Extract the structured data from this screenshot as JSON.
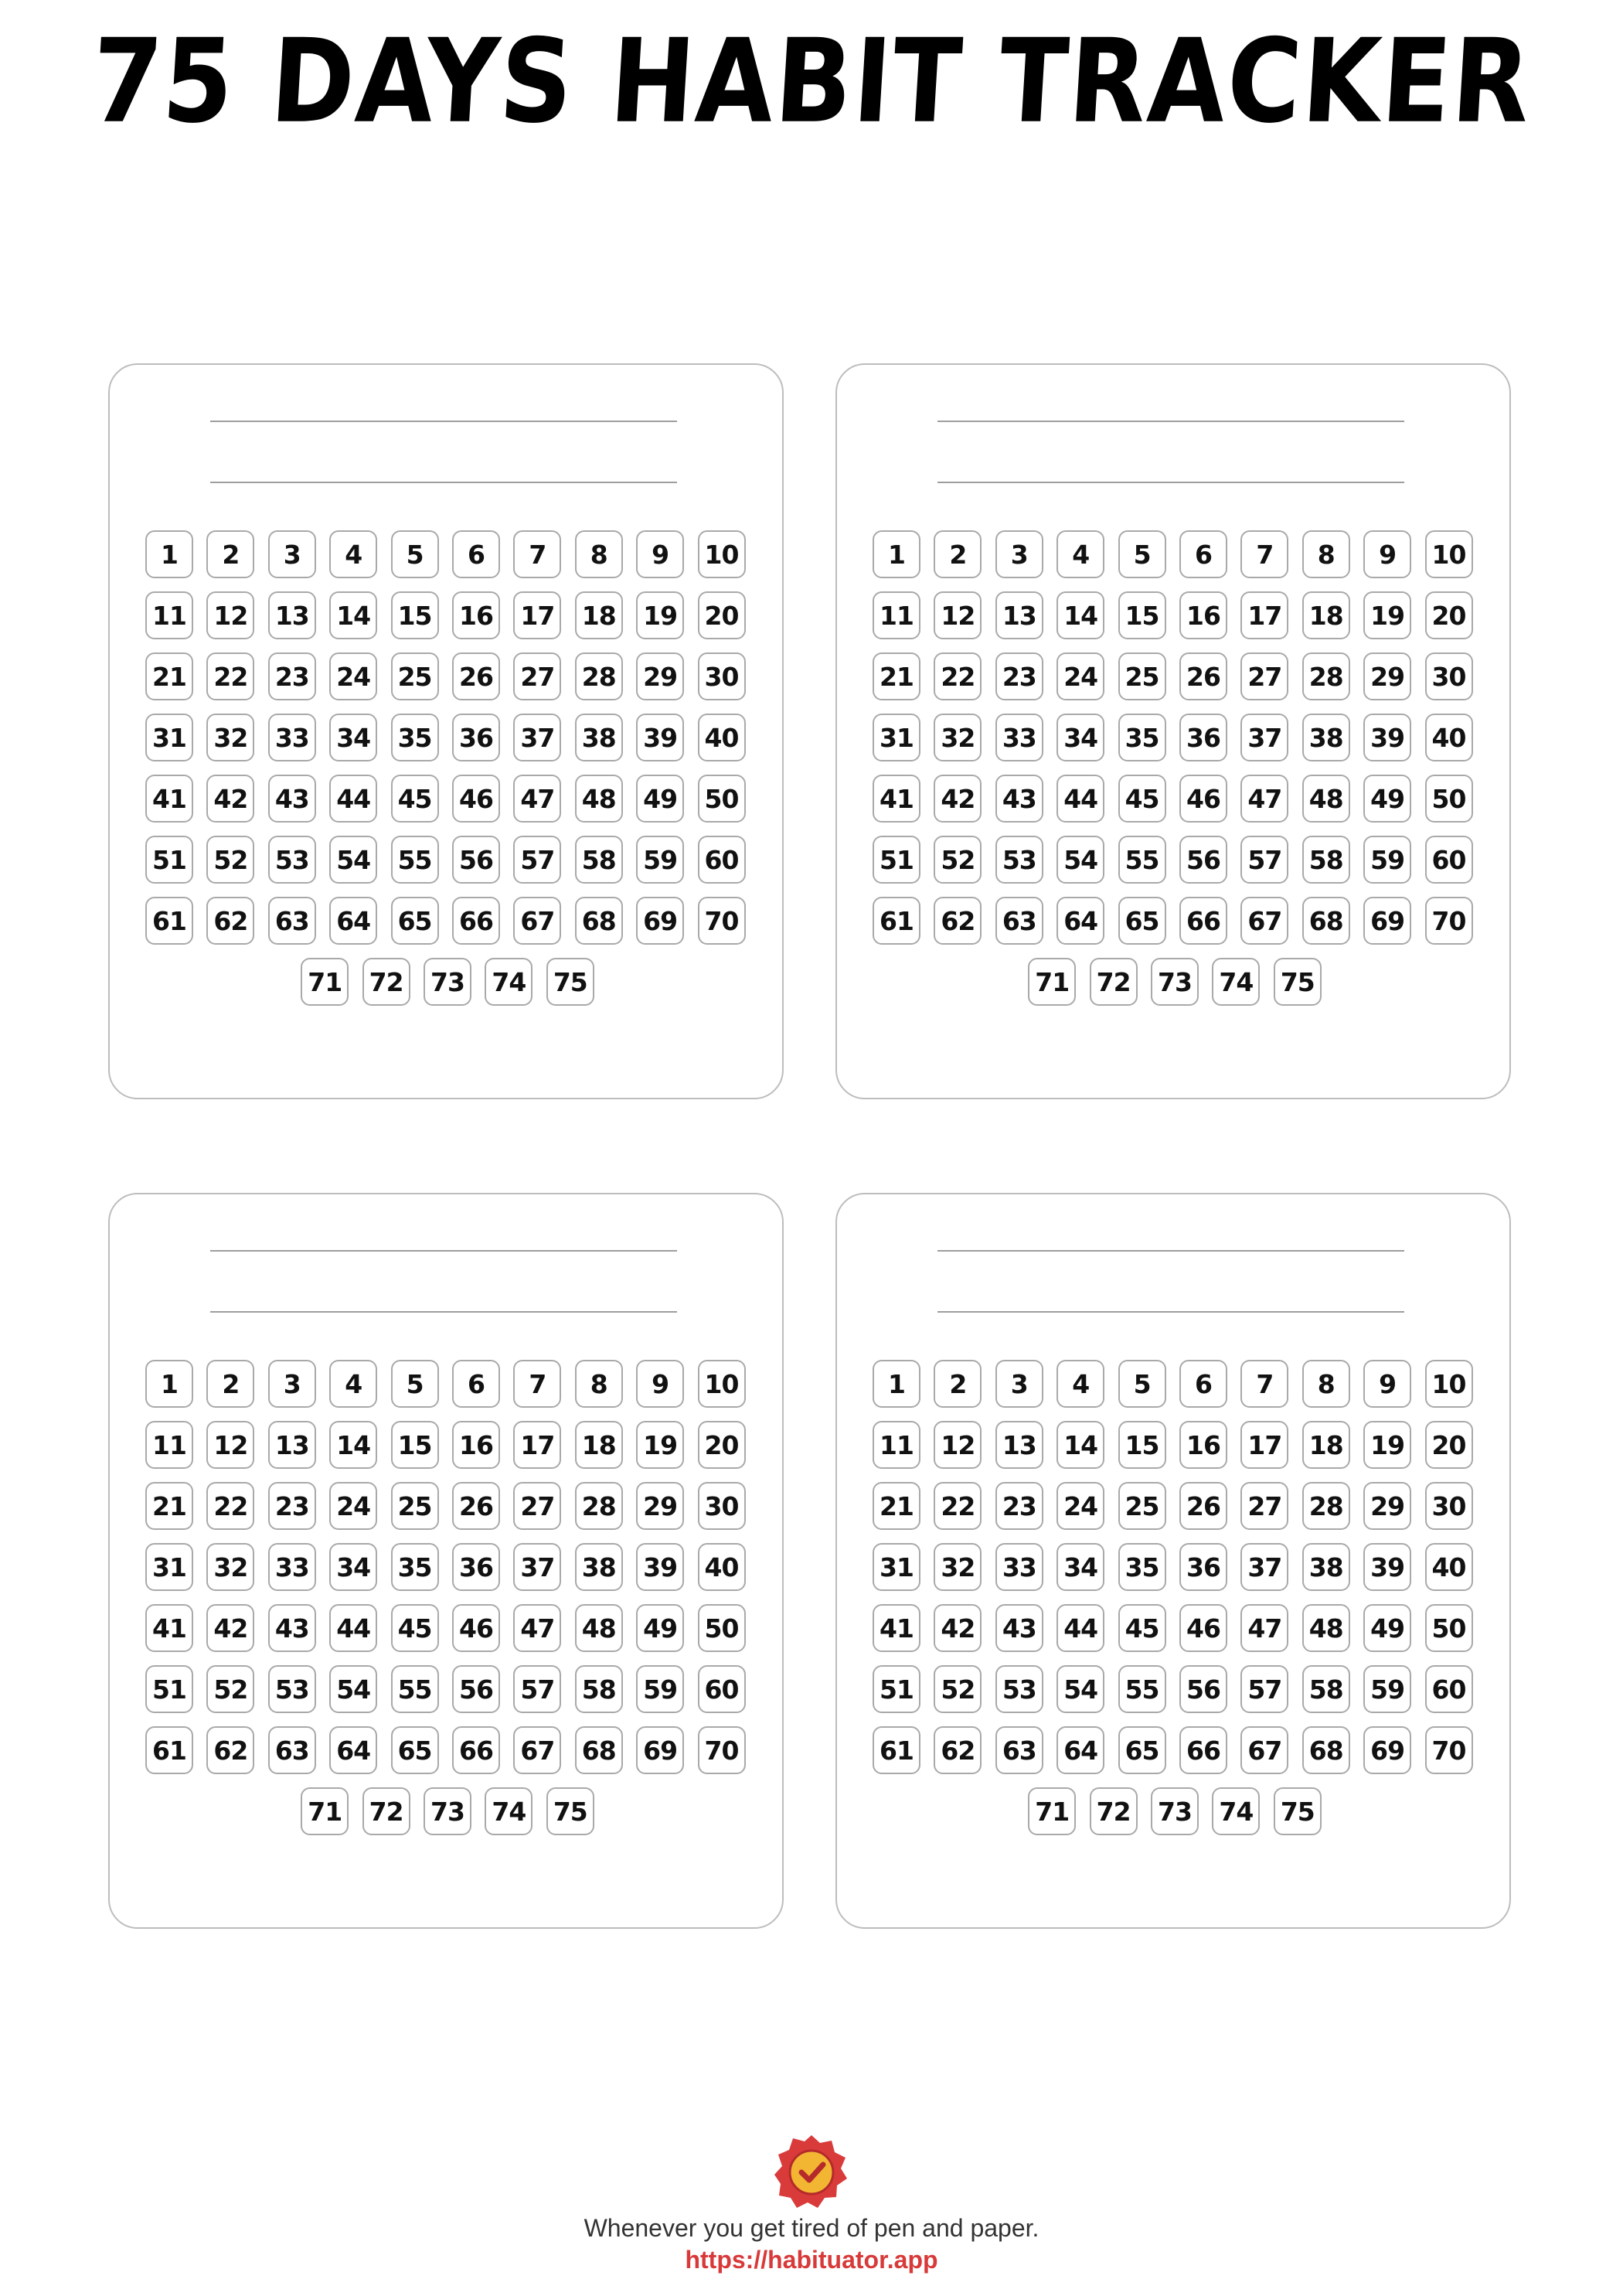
{
  "title": "75 DAYS HABIT TRACKER",
  "tracker": {
    "days": [
      1,
      2,
      3,
      4,
      5,
      6,
      7,
      8,
      9,
      10,
      11,
      12,
      13,
      14,
      15,
      16,
      17,
      18,
      19,
      20,
      21,
      22,
      23,
      24,
      25,
      26,
      27,
      28,
      29,
      30,
      31,
      32,
      33,
      34,
      35,
      36,
      37,
      38,
      39,
      40,
      41,
      42,
      43,
      44,
      45,
      46,
      47,
      48,
      49,
      50,
      51,
      52,
      53,
      54,
      55,
      56,
      57,
      58,
      59,
      60,
      61,
      62,
      63,
      64,
      65,
      66,
      67,
      68,
      69,
      70,
      71,
      72,
      73,
      74,
      75
    ],
    "panel_count": 4
  },
  "footer": {
    "logo_icon": "checkmark-badge-icon",
    "tagline": "Whenever you get tired of pen and paper.",
    "url": "https://habituator.app"
  },
  "colors": {
    "url": "#d83a3a",
    "badge_outer": "#d93b3b",
    "badge_inner": "#f2b632",
    "panel_border": "#bdbdbd"
  }
}
